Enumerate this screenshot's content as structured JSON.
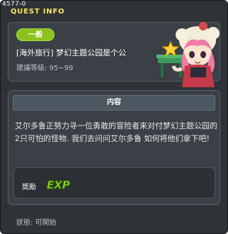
{
  "window": {
    "quest_id": "4577-0",
    "title": "QUEST INFO"
  },
  "quest": {
    "category": "一般",
    "name": "[海外旅行] 梦幻主题公园是个公",
    "required_level": "建議等級: 95~99"
  },
  "content": {
    "header": "内容",
    "description": "艾尔多鲁正努力寻一位勇敢的冒险者来对付梦幻主题公园的2只可怕的怪物. 我们去问问艾尔多鲁 如何将他们拿下吧!"
  },
  "reward": {
    "label": "獎勵",
    "icon": "exp-icon",
    "icon_text": "EXP"
  },
  "status": {
    "text": "狀態: 可開始"
  },
  "colors": {
    "title": "#f6e75a",
    "tag": "#8dc11f",
    "window_bg": "#2f3337"
  }
}
